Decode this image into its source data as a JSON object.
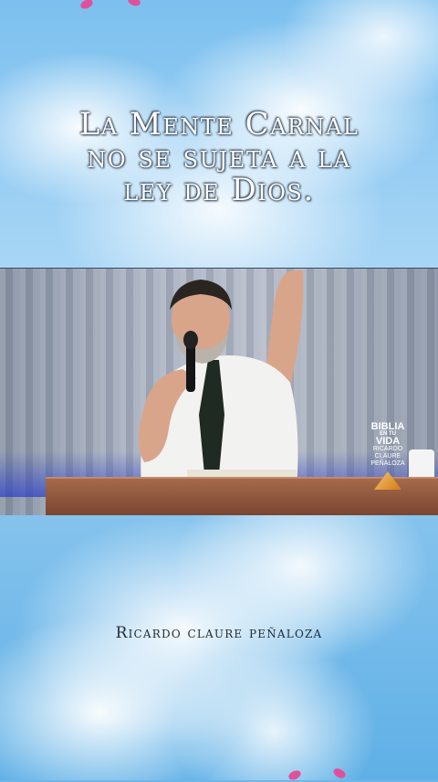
{
  "title_lines": [
    "La Mente Carnal",
    "no se sujeta a la",
    "ley de Dios."
  ],
  "author": "Ricardo claure peñaloza",
  "watermark": {
    "line1": "BIBLIA",
    "line2": "EN TU",
    "line3": "VIDA",
    "line4a": "RICARDO",
    "line4b": "CLAURE",
    "line4c": "PEÑALOZA"
  },
  "colors": {
    "sky": "#7cc0ef",
    "title_text": "#ffffff",
    "author_text": "#1e2a36",
    "accent_petals": "#e0509a"
  }
}
